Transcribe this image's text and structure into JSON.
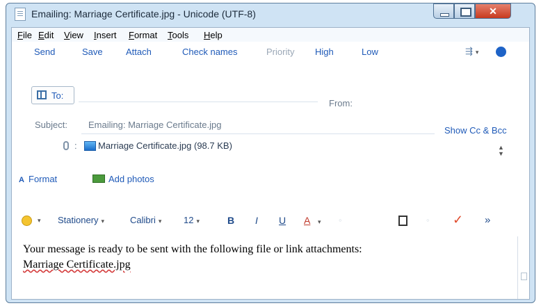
{
  "window": {
    "title": "Emailing: Marriage Certificate.jpg - Unicode (UTF-8)"
  },
  "menu": [
    "File",
    "Edit",
    "View",
    "Insert",
    "Format",
    "Tools",
    "Help"
  ],
  "commands": {
    "send": "Send",
    "save": "Save",
    "attach": "Attach",
    "check_names": "Check names",
    "priority": "Priority",
    "high": "High",
    "low": "Low"
  },
  "header": {
    "to_label": "To:",
    "to_value": "",
    "from_label": "From:",
    "subject_label": "Subject:",
    "subject_value": "Emailing: Marriage Certificate.jpg",
    "show_cc_bcc": "Show Cc & Bcc",
    "attachment_colon": ":",
    "attachment": "Marriage Certificate.jpg (98.7 KB)"
  },
  "tools": {
    "format": "Format",
    "add_photos": "Add photos"
  },
  "formatting": {
    "stationery": "Stationery",
    "font": "Calibri",
    "size": "12",
    "bold": "B",
    "italic": "I",
    "underline": "U",
    "color": "A",
    "more": "»"
  },
  "message": {
    "line1": "Your message is ready to be sent with the following file or link attachments:",
    "line2": "Marriage Certificate.jpg"
  },
  "icons": [
    "document-icon",
    "minimize-icon",
    "maximize-icon",
    "close-icon",
    "encoding-icon",
    "help-icon",
    "address-book-icon",
    "paperclip-icon",
    "image-file-icon",
    "format-icon",
    "add-photos-icon",
    "emoji-icon",
    "paste-icon",
    "spellcheck-icon"
  ],
  "colors": {
    "link_blue": "#1f5ab8",
    "frame": "#cfe3f4",
    "close_red": "#c73a1f"
  }
}
